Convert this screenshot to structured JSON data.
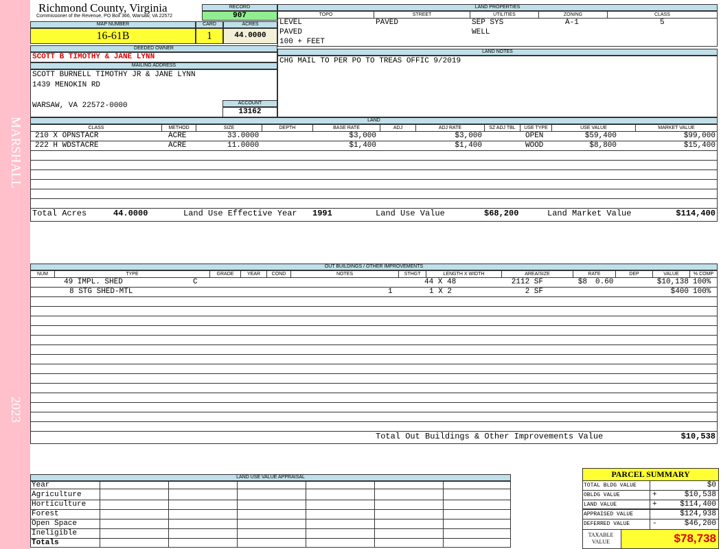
{
  "header": {
    "county": "Richmond County, Virginia",
    "commissioner": "Commissioner of the Revenue, PO Box 366, Warsaw, VA 22572",
    "record_label": "RECORD",
    "record": "907",
    "map_label": "MAP NUMBER",
    "map_number": "16-61B",
    "card_label": "CARD",
    "card": "1",
    "acres_label": "ACRES",
    "acres": "44.0000"
  },
  "sidebar": {
    "district": "MARSHALL",
    "year": "2023",
    "color": "#ffc0cb"
  },
  "owner": {
    "deeded_label": "DEEDED OWNER",
    "deeded_owner": "SCOTT B TIMOTHY & JANE LYNN",
    "mailing_label": "MAILING ADDRESS",
    "mailing_line1": "SCOTT BURNELL TIMOTHY JR & JANE LYNN",
    "mailing_line2": "1439 MENOKIN RD",
    "mailing_line3": "WARSAW, VA 22572-0000",
    "account_label": "ACCOUNT",
    "account": "13162"
  },
  "land_properties": {
    "title": "LAND PROPERTIES",
    "col_topo": "TOPO",
    "col_street": "STREET",
    "col_utilities": "UTILITIES",
    "col_zoning": "ZONING",
    "col_class": "CLASS",
    "topo1": "LEVEL",
    "topo2": "PAVED",
    "topo3": "100 + FEET",
    "street": "PAVED",
    "util1": "SEP SYS",
    "util2": "WELL",
    "zoning": "A-1",
    "class": "5"
  },
  "land_notes": {
    "title": "LAND NOTES",
    "text": "CHG MAIL TO PER PO TO TREAS OFFIC 9/2019"
  },
  "land": {
    "title": "LAND",
    "columns": {
      "class": "CLASS",
      "method": "METHOD",
      "size": "SIZE",
      "depth": "DEPTH",
      "base_rate": "BASE RATE",
      "adj": "ADJ",
      "adj_rate": "ADJ RATE",
      "sz_adj": "SZ ADJ TBL",
      "use_type": "USE TYPE",
      "use_value": "USE VALUE",
      "market_value": "MARKET VALUE"
    },
    "rows": [
      {
        "class": "210 X OPNSTACR",
        "method": "ACRE",
        "size": "33.0000",
        "base_rate": "$3,000",
        "adj_rate": "$3,000",
        "use_type": "OPEN",
        "use_value": "$59,400",
        "market_value": "$99,000"
      },
      {
        "class": "222 H WDSTACRE",
        "method": "ACRE",
        "size": "11.0000",
        "base_rate": "$1,400",
        "adj_rate": "$1,400",
        "use_type": "WOOD",
        "use_value": "$8,800",
        "market_value": "$15,400"
      }
    ],
    "total_acres_label": "Total Acres",
    "total_acres": "44.0000",
    "effective_year_label": "Land Use Effective Year",
    "effective_year": "1991",
    "use_value_label": "Land Use Value",
    "use_value": "$68,200",
    "market_value_label": "Land Market Value",
    "market_value": "$114,400"
  },
  "outbuildings": {
    "title": "OUT BUILDINGS / OTHER IMPROVEMENTS",
    "columns": {
      "num": "NUM",
      "type": "TYPE",
      "grade": "GRADE",
      "year": "YEAR",
      "cond": "COND",
      "notes": "NOTES",
      "sthgt": "STHGT",
      "lw": "LENGTH X WIDTH",
      "area": "AREA/SIZE",
      "rate": "RATE",
      "dep": "DEP",
      "value": "VALUE",
      "comp": "% COMP"
    },
    "rows": [
      {
        "type": "49 IMPL. SHED",
        "grade": "C",
        "sthgt": "",
        "lw": "44 X 48",
        "area": "2112 SF",
        "rate": "$8",
        "dep": "0.60",
        "value": "$10,138",
        "comp": "100%"
      },
      {
        "type": "8 STG SHED-MTL",
        "grade": "",
        "sthgt": "1",
        "lw": "1 X 2",
        "area": "2 SF",
        "rate": "",
        "dep": "",
        "value": "$400",
        "comp": "100%"
      }
    ],
    "total_label": "Total Out Buildings & Other Improvements Value",
    "total": "$10,538"
  },
  "land_use_appraisal": {
    "title": "LAND USE VALUE APPRAISAL",
    "rows": [
      "Year",
      "Agriculture",
      "Horticulture",
      "Forest",
      "Open Space",
      "Ineligible",
      "Totals"
    ]
  },
  "parcel_summary": {
    "title": "PARCEL SUMMARY",
    "bldg_label": "TOTAL BLDG VALUE",
    "bldg_op": "",
    "bldg_value": "$0",
    "obldg_label": "OBLDG VALUE",
    "obldg_op": "+",
    "obldg_value": "$10,538",
    "land_label": "LAND VALUE",
    "land_op": "+",
    "land_value": "$114,400",
    "appraised_label": "APPRAISED VALUE",
    "appraised_op": "",
    "appraised_value": "$124,938",
    "deferred_label": "DEFERRED VALUE",
    "deferred_op": "-",
    "deferred_value": "$46,200",
    "taxable_label_1": "TAXABLE",
    "taxable_label_2": "VALUE",
    "taxable_value": "$78,738"
  },
  "colors": {
    "yellow": "#ffff33",
    "header_blue": "#bfe0ea",
    "green": "#90ee90",
    "red": "#e00000",
    "stripe": "#eef0fa"
  }
}
